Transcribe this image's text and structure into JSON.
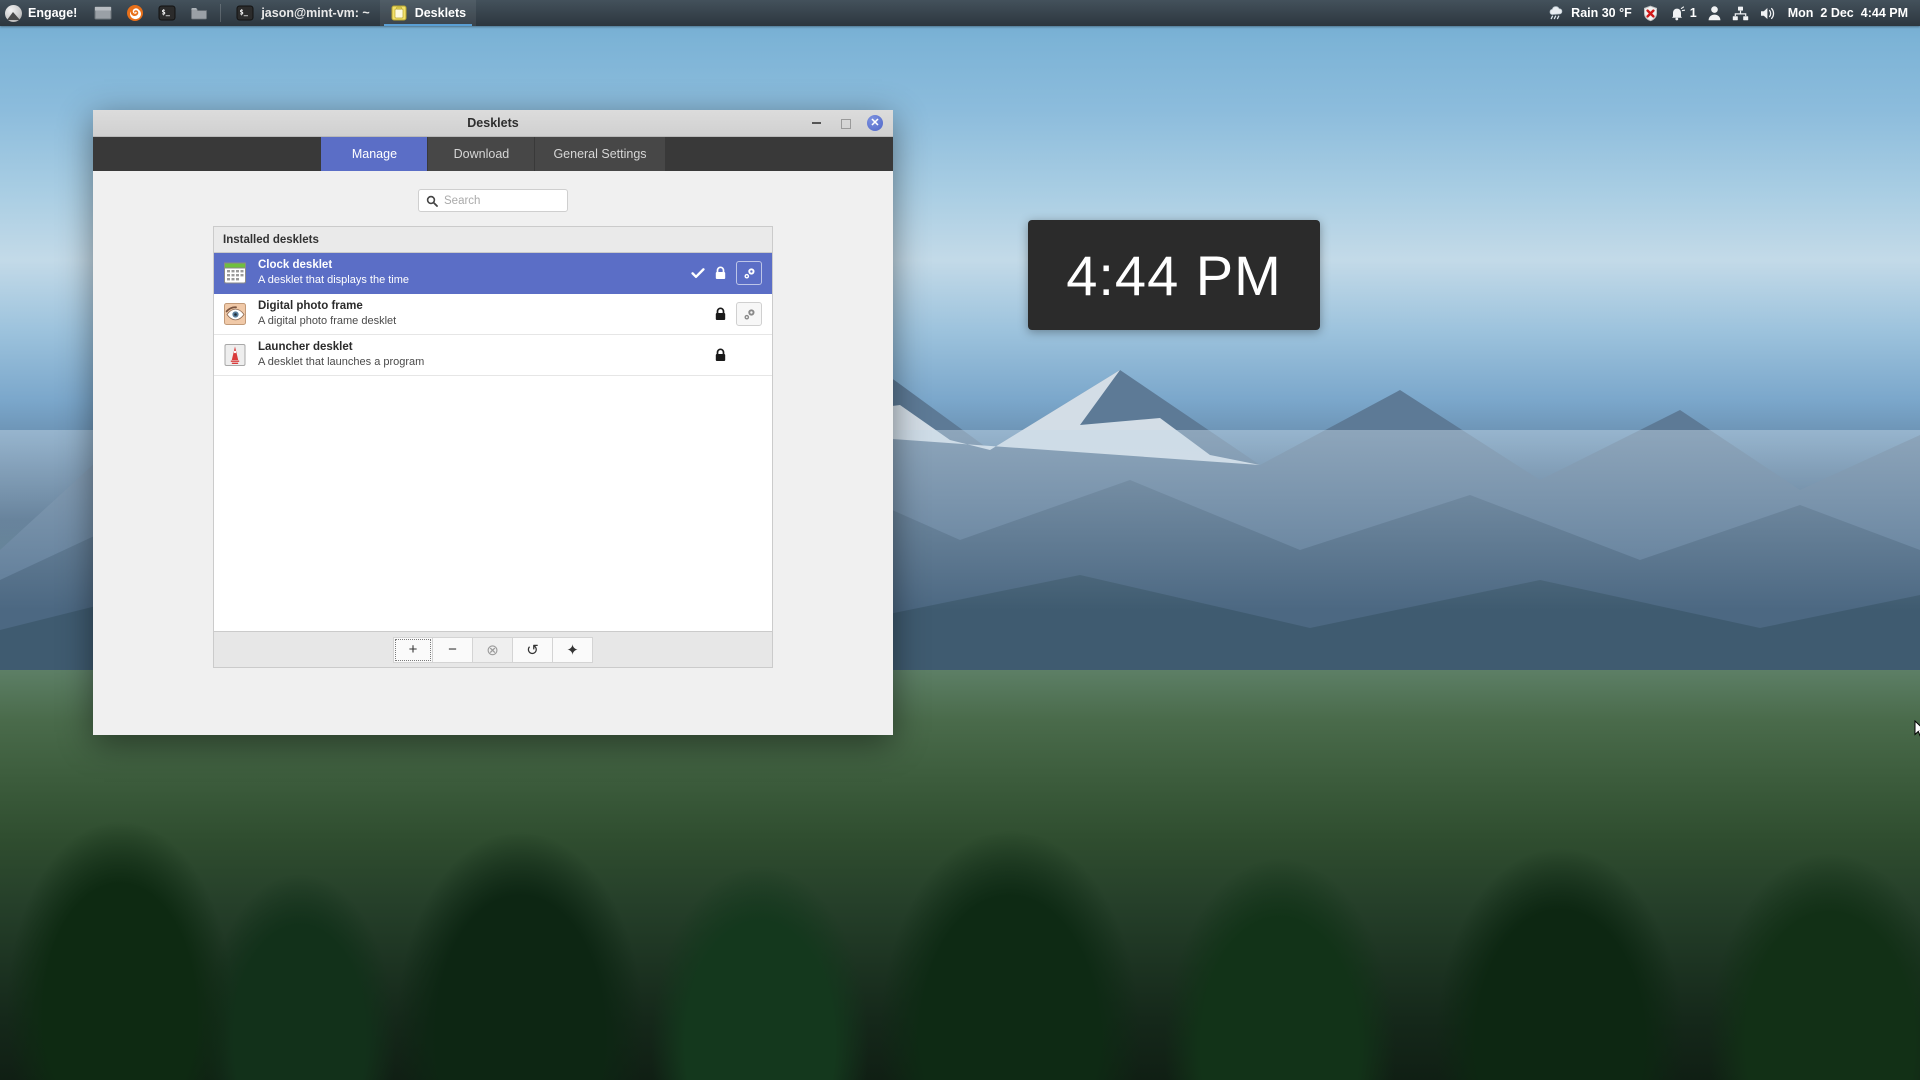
{
  "panel": {
    "menu": {
      "label": "Engage!",
      "icon": "mint-menu-icon"
    },
    "launchers": [
      {
        "name": "show-desktop-launcher",
        "icon": "window-icon"
      },
      {
        "name": "firefox-launcher",
        "icon": "firefox-icon"
      },
      {
        "name": "terminal-launcher",
        "icon": "terminal-icon"
      },
      {
        "name": "files-launcher",
        "icon": "folder-icon"
      }
    ],
    "windows": [
      {
        "title": "jason@mint-vm: ~",
        "icon": "terminal-icon",
        "active": false
      },
      {
        "title": "Desklets",
        "icon": "desklets-icon",
        "active": true
      }
    ],
    "tray": {
      "weather": {
        "icon": "rain-cloud-icon",
        "text": "Rain 30 °F"
      },
      "updates": {
        "icon": "shield-error-icon"
      },
      "notifications": {
        "icon": "bell-icon",
        "count": "1"
      },
      "user": {
        "icon": "user-icon"
      },
      "network": {
        "icon": "network-icon"
      },
      "sound": {
        "icon": "speaker-icon"
      },
      "clock": {
        "day": "Mon",
        "date": "2 Dec",
        "time": "4:44 PM"
      }
    }
  },
  "clock_desklet": {
    "time": "4:44 PM"
  },
  "window": {
    "title": "Desklets",
    "controls": {
      "minimize": "−",
      "maximize": "□",
      "close": "✕"
    },
    "tabs": [
      {
        "label": "Manage",
        "active": true
      },
      {
        "label": "Download",
        "active": false
      },
      {
        "label": "General Settings",
        "active": false
      }
    ],
    "search": {
      "value": "",
      "placeholder": "Search"
    },
    "list": {
      "header": "Installed desklets",
      "rows": [
        {
          "name": "Clock desklet",
          "description": "A desklet that displays the time",
          "icon": "clock-desklet-icon",
          "selected": true,
          "enabled": true,
          "locked": true,
          "configurable": true
        },
        {
          "name": "Digital photo frame",
          "description": "A digital photo frame desklet",
          "icon": "photo-frame-desklet-icon",
          "selected": false,
          "enabled": false,
          "locked": true,
          "configurable": true
        },
        {
          "name": "Launcher desklet",
          "description": "A desklet that launches a program",
          "icon": "launcher-desklet-icon",
          "selected": false,
          "enabled": false,
          "locked": true,
          "configurable": false
        }
      ]
    },
    "toolbar": [
      {
        "name": "add-desklet-button",
        "glyph": "+",
        "state": "focused"
      },
      {
        "name": "remove-desklet-button",
        "glyph": "−",
        "state": "normal"
      },
      {
        "name": "uninstall-desklet-button",
        "glyph": "⊗",
        "state": "disabled"
      },
      {
        "name": "restore-defaults-button",
        "glyph": "↺",
        "state": "normal"
      },
      {
        "name": "more-actions-button",
        "glyph": "✦",
        "state": "normal"
      }
    ]
  },
  "colors": {
    "accent": "#5b6ec6",
    "panel_bg": "#3a3e42",
    "tabstrip_bg": "#393939",
    "window_bg": "#f0f0f0",
    "desklet_bg": "#2b2b2b"
  }
}
